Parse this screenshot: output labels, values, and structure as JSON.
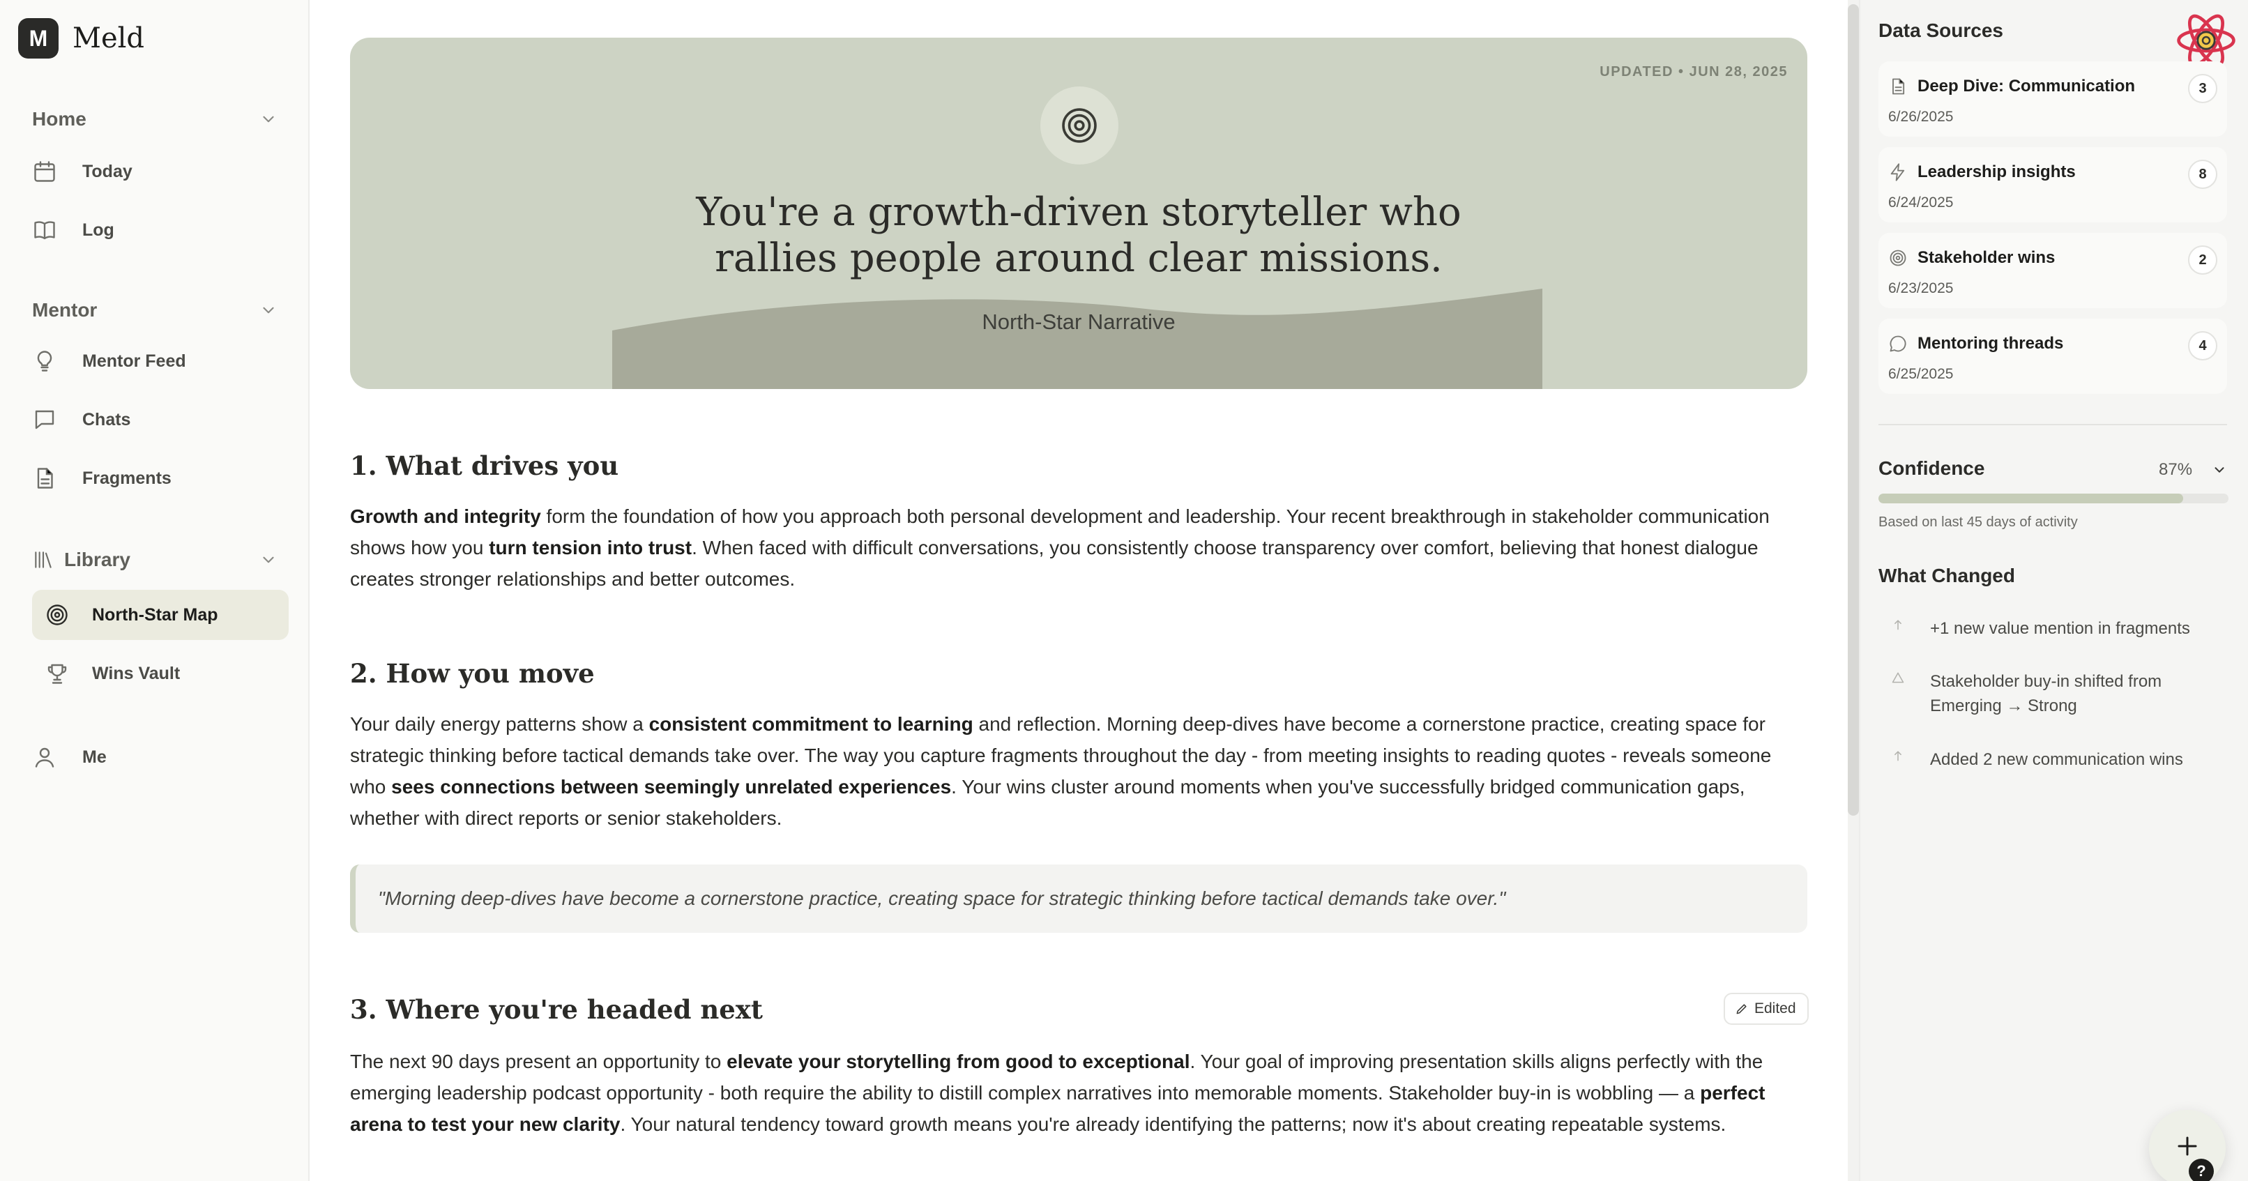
{
  "app": {
    "logo_letter": "M",
    "name": "Meld"
  },
  "sidebar": {
    "home": {
      "label": "Home",
      "items": [
        {
          "label": "Today",
          "icon": "calendar-icon"
        },
        {
          "label": "Log",
          "icon": "book-icon"
        }
      ]
    },
    "mentor": {
      "label": "Mentor",
      "items": [
        {
          "label": "Mentor Feed",
          "icon": "lightbulb-icon"
        },
        {
          "label": "Chats",
          "icon": "chat-icon"
        },
        {
          "label": "Fragments",
          "icon": "document-icon"
        }
      ]
    },
    "library": {
      "label": "Library",
      "items": [
        {
          "label": "North-Star Map",
          "icon": "target-icon",
          "active": true
        },
        {
          "label": "Wins Vault",
          "icon": "trophy-icon"
        }
      ]
    },
    "me": {
      "label": "Me",
      "icon": "user-icon"
    }
  },
  "hero": {
    "updated": "UPDATED • JUN 28, 2025",
    "title_line1": "You're a growth-driven storyteller who",
    "title_line2": "rallies people around clear missions.",
    "subtitle": "North-Star Narrative",
    "colors": {
      "background": "#cdd3c4",
      "hill": "#a7aa9a"
    }
  },
  "sections": [
    {
      "heading": "1. What drives you",
      "p": [
        {
          "b": "Growth and integrity"
        },
        {
          "t": " form the foundation of how you approach both personal development and leadership. Your recent breakthrough in stakeholder communication shows how you "
        },
        {
          "b": "turn tension into trust"
        },
        {
          "t": ". When faced with difficult conversations, you consistently choose transparency over comfort, believing that honest dialogue creates stronger relationships and better outcomes."
        }
      ]
    },
    {
      "heading": "2. How you move",
      "p": [
        {
          "t": "Your daily energy patterns show a "
        },
        {
          "b": "consistent commitment to learning"
        },
        {
          "t": " and reflection. Morning deep-dives have become a cornerstone practice, creating space for strategic thinking before tactical demands take over. The way you capture fragments throughout the day - from meeting insights to reading quotes - reveals someone who "
        },
        {
          "b": "sees connections between seemingly unrelated experiences"
        },
        {
          "t": ". Your wins cluster around moments when you've successfully bridged communication gaps, whether with direct reports or senior stakeholders."
        }
      ],
      "quote": "\"Morning deep-dives have become a cornerstone practice, creating space for strategic thinking before tactical demands take over.\""
    },
    {
      "heading": "3. Where you're headed next",
      "edited_label": "Edited",
      "p": [
        {
          "t": "The next 90 days present an opportunity to "
        },
        {
          "b": "elevate your storytelling from good to exceptional"
        },
        {
          "t": ". Your goal of improving presentation skills aligns perfectly with the emerging leadership podcast opportunity - both require the ability to distill complex narratives into memorable moments. Stakeholder buy-in is wobbling — a "
        },
        {
          "b": "perfect arena to test your new clarity"
        },
        {
          "t": ". Your natural tendency toward growth means you're already identifying the patterns; now it's about creating repeatable systems."
        }
      ]
    }
  ],
  "right_panel": {
    "data_sources_title": "Data Sources",
    "sources": [
      {
        "name": "Deep Dive: Communication",
        "date": "6/26/2025",
        "count": "3",
        "icon": "document-icon"
      },
      {
        "name": "Leadership insights",
        "date": "6/24/2025",
        "count": "8",
        "icon": "lightning-icon"
      },
      {
        "name": "Stakeholder wins",
        "date": "6/23/2025",
        "count": "2",
        "icon": "target-icon"
      },
      {
        "name": "Mentoring threads",
        "date": "6/25/2025",
        "count": "4",
        "icon": "chat-icon"
      }
    ],
    "confidence": {
      "label": "Confidence",
      "value_text": "87%",
      "value": 0.87,
      "note": "Based on last 45 days of activity",
      "bar_color": "#c6cdb8"
    },
    "what_changed": {
      "title": "What Changed",
      "items": [
        {
          "text": "+1 new value mention in fragments",
          "icon": "arrow-up-icon"
        },
        {
          "text": "Stakeholder buy-in shifted from Emerging → Strong",
          "icon": "triangle-icon"
        },
        {
          "text": "Added 2 new communication wins",
          "icon": "arrow-up-icon"
        }
      ]
    }
  },
  "fab": {
    "icon": "plus-icon",
    "help_label": "?"
  }
}
